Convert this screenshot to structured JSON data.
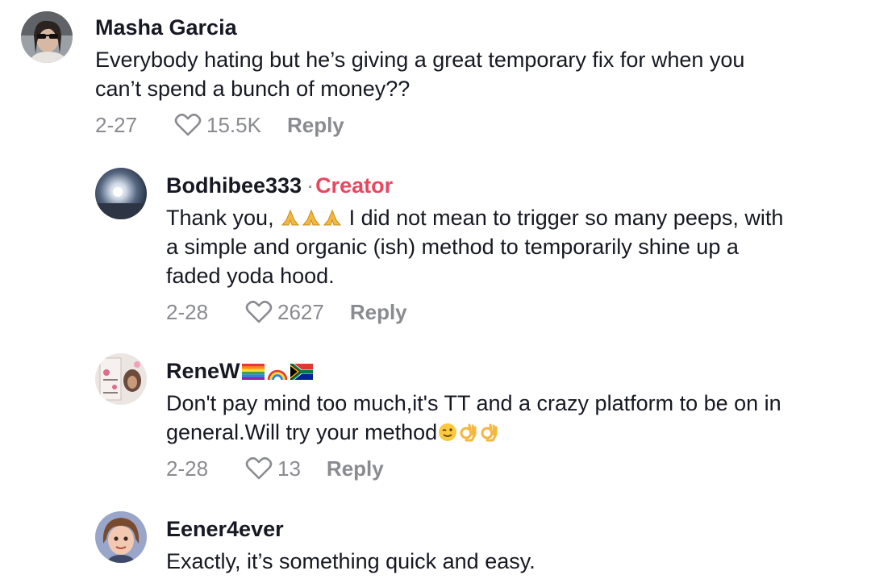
{
  "comments": [
    {
      "username": "Masha Garcia",
      "text_lines": [
        "Everybody hating but he’s giving a great temporary fix for when you",
        "can’t spend a bunch of money??"
      ],
      "date": "2-27",
      "likes": "15.5K",
      "reply_label": "Reply"
    },
    {
      "username": "Bodhibee333",
      "separator": "·",
      "badge": "Creator",
      "text_prefix": "Thank you, ",
      "emoji_names": [
        "folded-hands",
        "folded-hands",
        "folded-hands"
      ],
      "text_first": "I did not mean to trigger so many peeps, with",
      "text_lines": [
        "a simple and organic (ish) method to temporarily shine up a",
        "faded yoda hood."
      ],
      "date": "2-28",
      "likes": "2627",
      "reply_label": "Reply"
    },
    {
      "username": "ReneW",
      "flags": [
        "rainbow-flag",
        "rainbow",
        "south-africa-flag"
      ],
      "text_lines": [
        "Don't pay mind too much,it's TT and a crazy platform to be on in",
        "general.Will try your method"
      ],
      "trailing_emojis": [
        "winking-face",
        "ok-hand",
        "ok-hand"
      ],
      "date": "2-28",
      "likes": "13",
      "reply_label": "Reply"
    },
    {
      "username": "Eener4ever",
      "text_lines": [
        "Exactly, it’s something quick and easy."
      ]
    }
  ],
  "colors": {
    "text": "#161823",
    "muted": "#8a8b91",
    "creator": "#e8475f"
  }
}
